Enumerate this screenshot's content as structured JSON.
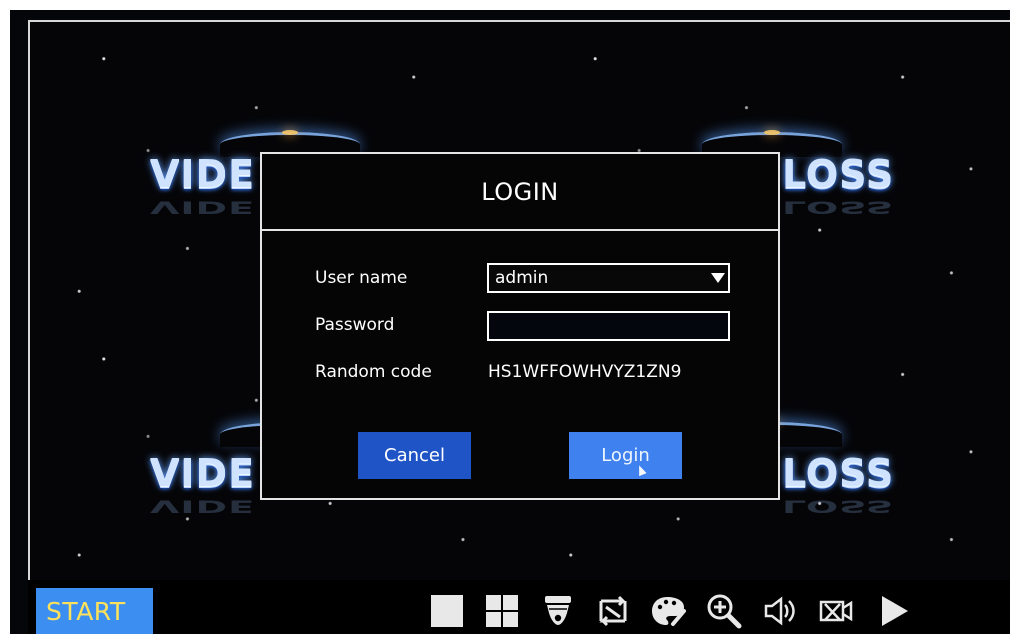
{
  "video_loss": {
    "left_text": "VIDE",
    "right_text": "LOSS"
  },
  "dialog": {
    "title": "LOGIN",
    "user_name_label": "User name",
    "user_name_value": "admin",
    "password_label": "Password",
    "password_value": "",
    "random_code_label": "Random code",
    "random_code_value": "HS1WFFOWHVYZ1ZN9",
    "cancel_label": "Cancel",
    "login_label": "Login"
  },
  "taskbar": {
    "start_label": "START",
    "icons": [
      "single-view-icon",
      "quad-view-icon",
      "dome-camera-icon",
      "cycle-icon",
      "palette-icon",
      "zoom-in-icon",
      "speaker-icon",
      "camera-off-icon",
      "play-icon"
    ]
  },
  "colors": {
    "monitor_bg": "#05060a",
    "dialog_border": "#e5e5e5",
    "cancel_button": "#1f54c7",
    "login_button": "#3f82ef",
    "start_button": "#3c8ff0",
    "start_text": "#ffe25a"
  }
}
